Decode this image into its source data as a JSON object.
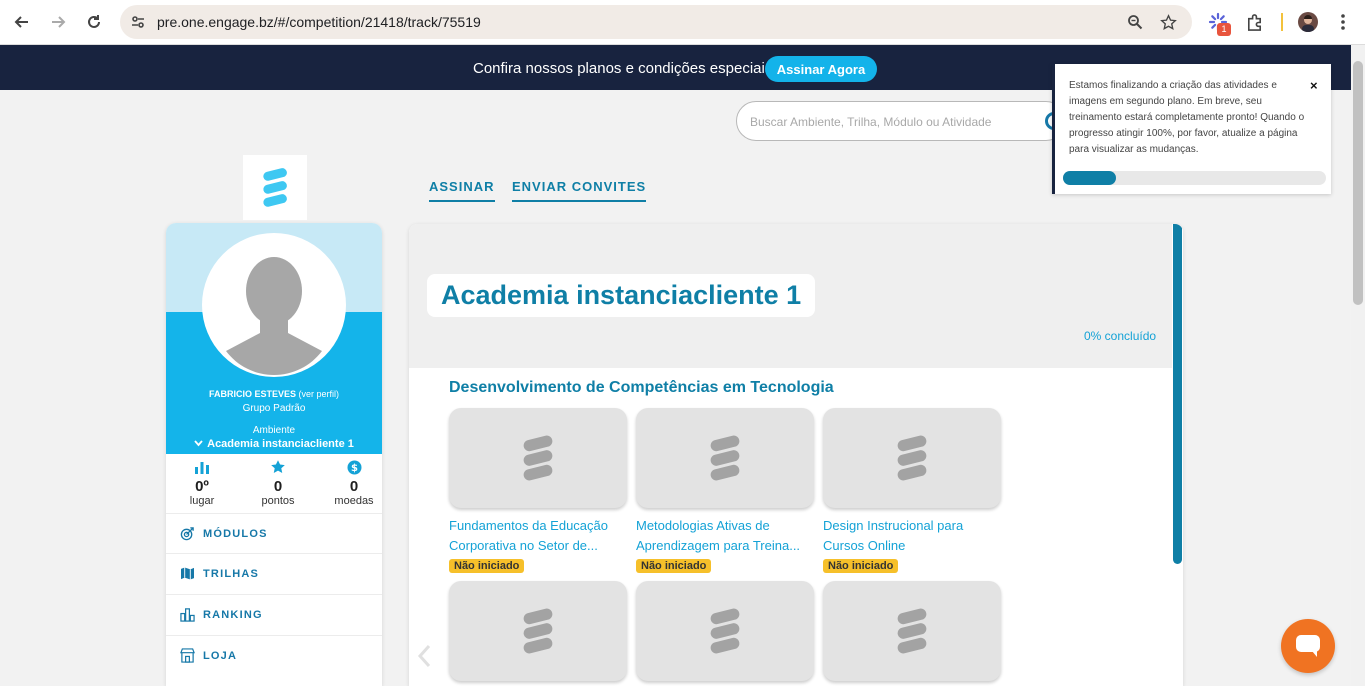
{
  "browser": {
    "url": "pre.one.engage.bz/#/competition/21418/track/75519",
    "extension_badge": "1"
  },
  "banner": {
    "text": "Confira nossos planos e condições especiais.",
    "cta": "Assinar Agora"
  },
  "search": {
    "placeholder": "Buscar Ambiente, Trilha, Módulo ou Atividade"
  },
  "notification": {
    "text": "Estamos finalizando a criação das atividades e imagens em segundo plano. Em breve, seu treinamento estará completamente pronto! Quando o progresso atingir 100%, por favor, atualize a página para visualizar as mudanças.",
    "close": "×",
    "progress": 0.2
  },
  "toplinks": {
    "subscribe": "ASSINAR",
    "invite": "ENVIAR CONVITES"
  },
  "profile": {
    "name": "FABRICIO ESTEVES",
    "view_profile": "(ver perfil)",
    "group": "Grupo Padrão",
    "env_label": "Ambiente",
    "env_name": "Academia instanciacliente 1",
    "stats": [
      {
        "value": "0º",
        "label": "lugar",
        "icon": "bar-chart-icon"
      },
      {
        "value": "0",
        "label": "pontos",
        "icon": "star-icon"
      },
      {
        "value": "0",
        "label": "moedas",
        "icon": "coin-icon"
      }
    ],
    "menu": [
      {
        "label": "MÓDULOS",
        "icon": "target-icon"
      },
      {
        "label": "TRILHAS",
        "icon": "map-icon"
      },
      {
        "label": "RANKING",
        "icon": "ranking-icon"
      },
      {
        "label": "LOJA",
        "icon": "store-icon"
      }
    ]
  },
  "main": {
    "title": "Academia instanciacliente 1",
    "progress_text": "0% concluído",
    "section_title": "Desenvolvimento de Competências em Tecnologia",
    "courses": [
      {
        "title": "Fundamentos da Educação Corporativa no Setor de...",
        "status": "Não iniciado"
      },
      {
        "title": "Metodologias Ativas de Aprendizagem para Treina...",
        "status": "Não iniciado"
      },
      {
        "title": "Design Instrucional para Cursos Online",
        "status": "Não iniciado"
      },
      {
        "title": "",
        "status": ""
      },
      {
        "title": "",
        "status": ""
      },
      {
        "title": "",
        "status": ""
      }
    ]
  },
  "colors": {
    "brand_blue": "#0f7fa6",
    "accent_cyan": "#14b4ea",
    "banner_navy": "#18233f",
    "badge_yellow": "#f6c02a",
    "chat_orange": "#f07322"
  }
}
